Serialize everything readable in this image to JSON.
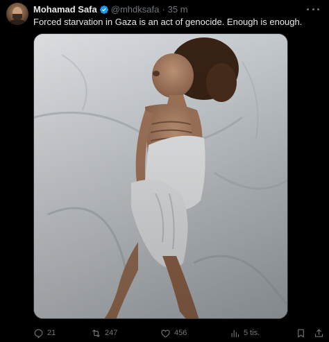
{
  "post": {
    "author_name": "Mohamad Safa",
    "handle": "@mhdksafa",
    "separator": "·",
    "timestamp": "35 m",
    "text": "Forced starvation in Gaza is an act of genocide. Enough is enough.",
    "verified": true
  },
  "actions": {
    "replies": "21",
    "reposts": "247",
    "likes": "456",
    "views": "5 tis."
  },
  "colors": {
    "background": "#000000",
    "text": "#e7e9ea",
    "muted": "#71767b",
    "verified": "#1d9bf0"
  },
  "icons": {
    "verified": "verified-badge-icon",
    "more": "more-icon",
    "reply": "reply-icon",
    "repost": "repost-icon",
    "like": "heart-icon",
    "views": "views-icon",
    "bookmark": "bookmark-icon",
    "share": "share-icon"
  }
}
